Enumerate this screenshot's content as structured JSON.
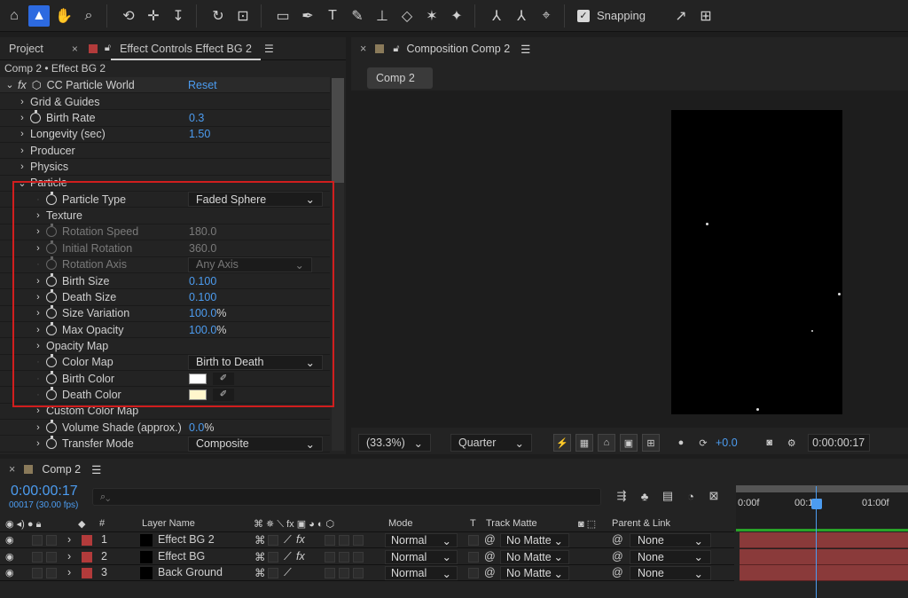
{
  "toolbar": {
    "tools": [
      "home-icon",
      "selection-tool-icon",
      "hand-tool-icon",
      "zoom-tool-icon",
      "orbit-camera-icon",
      "pan-camera-icon",
      "dolly-camera-icon",
      "rotation-tool-icon",
      "anchor-point-tool-icon",
      "rectangle-tool-icon",
      "pen-tool-icon",
      "type-tool-icon",
      "brush-tool-icon",
      "clone-stamp-icon",
      "eraser-icon",
      "roto-brush-icon",
      "puppet-pin-icon"
    ],
    "snapping_label": "Snapping"
  },
  "effect_controls": {
    "tab_project": "Project",
    "tab_label": "Effect Controls Effect BG 2",
    "path": "Comp 2 • Effect BG 2",
    "effect_name": "CC Particle World",
    "reset_label": "Reset",
    "rows": [
      {
        "name": "Grid & Guides"
      },
      {
        "name": "Birth Rate",
        "value": "0.3"
      },
      {
        "name": "Longevity (sec)",
        "value": "1.50"
      },
      {
        "name": "Producer"
      },
      {
        "name": "Physics"
      },
      {
        "name": "Particle"
      },
      {
        "name": "Particle Type",
        "value": "Faded Sphere"
      },
      {
        "name": "Texture"
      },
      {
        "name": "Rotation Speed",
        "value": "180.0"
      },
      {
        "name": "Initial Rotation",
        "value": "360.0"
      },
      {
        "name": "Rotation Axis",
        "value": "Any Axis"
      },
      {
        "name": "Birth Size",
        "value": "0.100"
      },
      {
        "name": "Death Size",
        "value": "0.100"
      },
      {
        "name": "Size Variation",
        "value": "100.0",
        "unit": "%"
      },
      {
        "name": "Max Opacity",
        "value": "100.0",
        "unit": "%"
      },
      {
        "name": "Opacity Map"
      },
      {
        "name": "Color Map",
        "value": "Birth to Death"
      },
      {
        "name": "Birth Color",
        "color": "#ffffff"
      },
      {
        "name": "Death Color",
        "color": "#fff6cc"
      },
      {
        "name": "Custom Color Map"
      },
      {
        "name": "Volume Shade (approx.)",
        "value": "0.0",
        "unit": "%"
      },
      {
        "name": "Transfer Mode",
        "value": "Composite"
      }
    ]
  },
  "composition": {
    "tab_label": "Composition Comp 2",
    "comp_button": "Comp 2",
    "zoom": "(33.3%)",
    "resolution": "Quarter",
    "exposure": "+0.0",
    "timecode": "0:00:00:17"
  },
  "timeline": {
    "tab_label": "Comp 2",
    "current_time": "0:00:00:17",
    "frame_info": "00017 (30.00 fps)",
    "search_placeholder": "",
    "ruler": [
      "0:00f",
      "00:15f",
      "01:00f"
    ],
    "headers": {
      "number": "#",
      "layer_name": "Layer Name",
      "mode": "Mode",
      "t": "T",
      "track_matte": "Track Matte",
      "parent": "Parent & Link"
    },
    "layers": [
      {
        "num": "1",
        "name": "Effect BG 2",
        "mode": "Normal",
        "matte": "No Matte",
        "parent": "None"
      },
      {
        "num": "2",
        "name": "Effect BG",
        "mode": "Normal",
        "matte": "No Matte",
        "parent": "None"
      },
      {
        "num": "3",
        "name": "Back Ground",
        "mode": "Normal",
        "matte": "No Matte",
        "parent": "None"
      }
    ]
  }
}
